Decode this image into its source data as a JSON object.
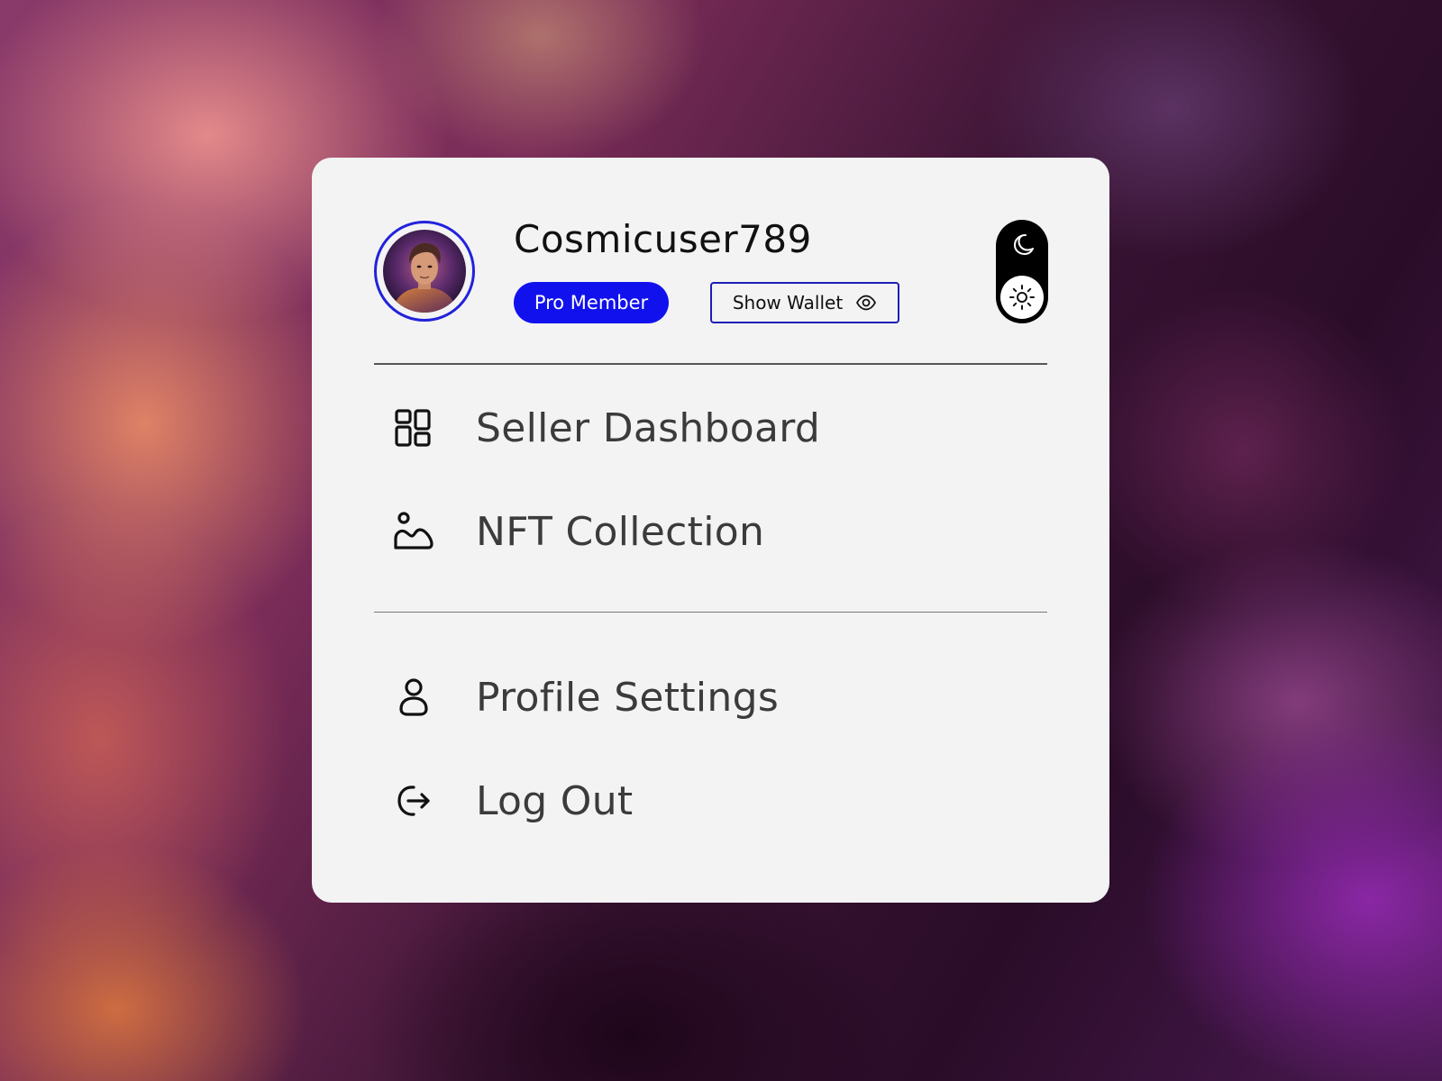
{
  "profile": {
    "username": "Cosmicuser789",
    "badge": "Pro Member",
    "wallet_button": "Show Wallet"
  },
  "theme_toggle": {
    "options": [
      "dark",
      "light"
    ],
    "selected": "light"
  },
  "menu": {
    "primary": [
      {
        "label": "Seller Dashboard",
        "icon": "grid-icon"
      },
      {
        "label": "NFT Collection",
        "icon": "image-collection-icon"
      }
    ],
    "secondary": [
      {
        "label": "Profile Settings",
        "icon": "user-icon"
      },
      {
        "label": "Log Out",
        "icon": "logout-icon"
      }
    ]
  },
  "colors": {
    "accent": "#1111ee",
    "card": "#f3f3f3",
    "text": "#3b3b3b"
  }
}
